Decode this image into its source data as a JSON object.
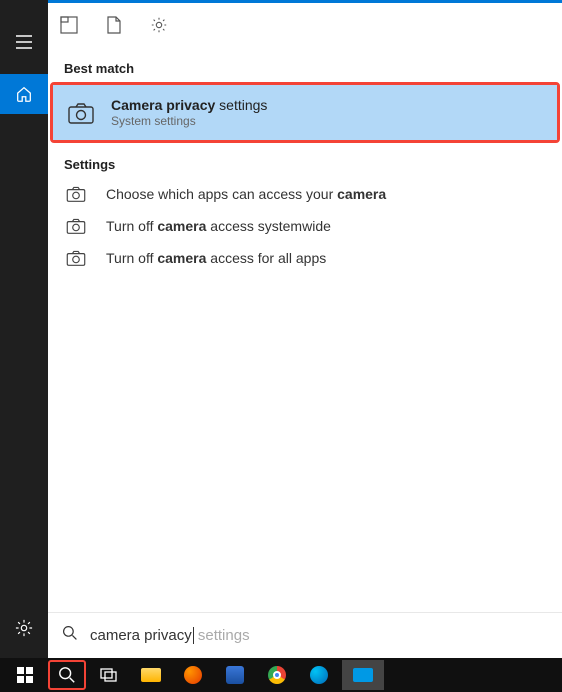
{
  "labels": {
    "best_match": "Best match",
    "settings": "Settings"
  },
  "best_match": {
    "title_pre": "Camera privacy",
    "title_post": " settings",
    "subtitle": "System settings"
  },
  "settings_items": [
    {
      "pre": "Choose which apps can access your ",
      "bold": "camera",
      "post": ""
    },
    {
      "pre": "Turn off ",
      "bold": "camera",
      "post": " access systemwide"
    },
    {
      "pre": "Turn off ",
      "bold": "camera",
      "post": " access for all apps"
    }
  ],
  "search": {
    "typed": "camera privacy",
    "suggest": " settings"
  }
}
